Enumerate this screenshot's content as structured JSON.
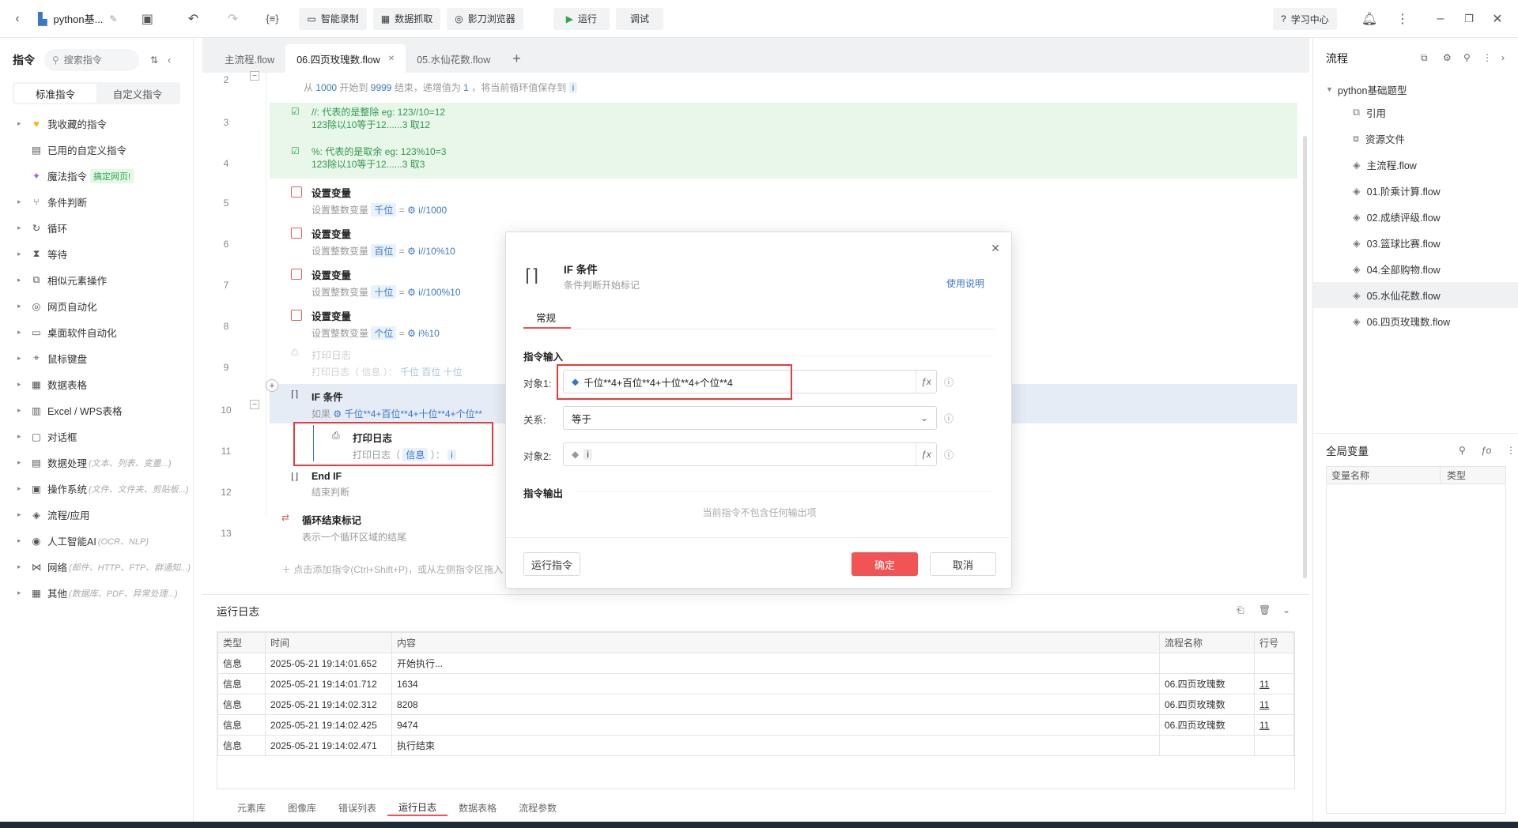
{
  "topbar": {
    "project_name": "python基...",
    "buttons": [
      "智能录制",
      "数据抓取",
      "影刀浏览器"
    ],
    "run": "运行",
    "debug": "调试",
    "learn": "学习中心"
  },
  "left": {
    "title": "指令",
    "search_placeholder": "搜索指令",
    "tab_standard": "标准指令",
    "tab_custom": "自定义指令",
    "items": [
      {
        "label": "我收藏的指令",
        "hint": "",
        "arrow": true,
        "icon": "heart-icon"
      },
      {
        "label": "已用的自定义指令",
        "hint": "",
        "arrow": false,
        "icon": "box-icon"
      },
      {
        "label": "魔法指令",
        "hint": "",
        "badge": "搞定网页!",
        "arrow": false,
        "icon": "magic-icon"
      },
      {
        "label": "条件判断",
        "hint": "",
        "arrow": true,
        "icon": "branch-icon"
      },
      {
        "label": "循环",
        "hint": "",
        "arrow": true,
        "icon": "loop-icon"
      },
      {
        "label": "等待",
        "hint": "",
        "arrow": true,
        "icon": "hourglass-icon"
      },
      {
        "label": "相似元素操作",
        "hint": "",
        "arrow": true,
        "icon": "copy-icon"
      },
      {
        "label": "网页自动化",
        "hint": "",
        "arrow": true,
        "icon": "globe-icon"
      },
      {
        "label": "桌面软件自动化",
        "hint": "",
        "arrow": true,
        "icon": "monitor-icon"
      },
      {
        "label": "鼠标键盘",
        "hint": "",
        "arrow": true,
        "icon": "mouse-icon"
      },
      {
        "label": "数据表格",
        "hint": "",
        "arrow": true,
        "icon": "table-icon"
      },
      {
        "label": "Excel / WPS表格",
        "hint": "",
        "arrow": true,
        "icon": "excel-icon"
      },
      {
        "label": "对话框",
        "hint": "",
        "arrow": true,
        "icon": "dialog-icon"
      },
      {
        "label": "数据处理",
        "hint": "(文本、列表、变量...)",
        "arrow": true,
        "icon": "data-icon"
      },
      {
        "label": "操作系统",
        "hint": "(文件、文件夹、剪贴板...)",
        "arrow": true,
        "icon": "os-icon"
      },
      {
        "label": "流程/应用",
        "hint": "",
        "arrow": true,
        "icon": "layers-icon"
      },
      {
        "label": "人工智能AI",
        "hint": "(OCR、NLP)",
        "arrow": true,
        "icon": "ai-icon"
      },
      {
        "label": "网络",
        "hint": "(邮件、HTTP、FTP、群通知...)",
        "arrow": true,
        "icon": "network-icon"
      },
      {
        "label": "其他",
        "hint": "(数据库、PDF、异常处理...)",
        "arrow": true,
        "icon": "grid-icon"
      }
    ]
  },
  "tabs": [
    {
      "label": "主流程.flow",
      "active": false,
      "close": false
    },
    {
      "label": "06.四页玫瑰数.flow",
      "active": true,
      "close": true
    },
    {
      "label": "05.水仙花数.flow",
      "active": false,
      "close": false
    }
  ],
  "editor": {
    "loop_desc": {
      "a": "从",
      "from": "1000",
      "b": "开始到",
      "to": "9999",
      "c": "结束，递增值为",
      "step": "1",
      "d": "，将当前循环值保存到",
      "var": "i"
    },
    "comment1": {
      "l1": "//: 代表的是整除  eg: 123//10=12",
      "l2": "123除以10等于12......3  取12"
    },
    "comment2": {
      "l1": "%: 代表的是取余  eg: 123%10=3",
      "l2": "123除以10等于12......3  取3"
    },
    "setvars": [
      {
        "title": "设置变量",
        "sub": "设置整数变量",
        "var": "千位",
        "expr": "i//1000"
      },
      {
        "title": "设置变量",
        "sub": "设置整数变量",
        "var": "百位",
        "expr": "i//10%10"
      },
      {
        "title": "设置变量",
        "sub": "设置整数变量",
        "var": "十位",
        "expr": "i//100%10"
      },
      {
        "title": "设置变量",
        "sub": "设置整数变量",
        "var": "个位",
        "expr": "i%10"
      }
    ],
    "disabled_log": {
      "title": "打印日志",
      "sub": "打印日志（ 信息 ）：",
      "vars": "千位  百位  十位"
    },
    "if": {
      "title": "IF 条件",
      "pre": "如果",
      "expr": "千位**4+百位**4+十位**4+个位**"
    },
    "print": {
      "title": "打印日志",
      "pre": "打印日志（",
      "level": "信息",
      "post": "）：",
      "var": "i"
    },
    "endif": {
      "title": "End IF",
      "sub": "结束判断"
    },
    "loopend": {
      "title": "循环结束标记",
      "sub": "表示一个循环区域的结尾"
    },
    "add_hint": "点击添加指令(Ctrl+Shift+P)，或从左侧指令区拖入",
    "line_numbers": [
      "2",
      "3",
      "4",
      "5",
      "6",
      "7",
      "8",
      "9",
      "10",
      "11",
      "12",
      "13"
    ]
  },
  "log": {
    "title": "运行日志",
    "headers": [
      "类型",
      "时间",
      "内容",
      "流程名称",
      "行号"
    ],
    "rows": [
      [
        "信息",
        "2025-05-21 19:14:01.652",
        "开始执行...",
        "",
        ""
      ],
      [
        "信息",
        "2025-05-21 19:14:01.712",
        "1634",
        "06.四页玫瑰数",
        "11"
      ],
      [
        "信息",
        "2025-05-21 19:14:02.312",
        "8208",
        "06.四页玫瑰数",
        "11"
      ],
      [
        "信息",
        "2025-05-21 19:14:02.425",
        "9474",
        "06.四页玫瑰数",
        "11"
      ],
      [
        "信息",
        "2025-05-21 19:14:02.471",
        "执行结束",
        "",
        ""
      ]
    ],
    "bottom_tabs": [
      "元素库",
      "图像库",
      "错误列表",
      "运行日志",
      "数据表格",
      "流程参数"
    ]
  },
  "right": {
    "title": "流程",
    "root": "python基础题型",
    "items": [
      "引用",
      "资源文件",
      "主流程.flow",
      "01.阶乘计算.flow",
      "02.成绩评级.flow",
      "03.篮球比赛.flow",
      "04.全部购物.flow",
      "05.水仙花数.flow",
      "06.四页玫瑰数.flow"
    ],
    "globals_title": "全局变量",
    "globals_headers": [
      "变量名称",
      "类型"
    ]
  },
  "modal": {
    "title": "IF 条件",
    "subtitle": "条件判断开始标记",
    "help": "使用说明",
    "tab": "常规",
    "input_section": "指令输入",
    "obj1_label": "对象1:",
    "obj1_value": "千位**4+百位**4+十位**4+个位**4",
    "rel_label": "关系:",
    "rel_value": "等于",
    "obj2_label": "对象2:",
    "obj2_value": "i",
    "output_section": "指令输出",
    "no_output": "当前指令不包含任何输出项",
    "run_btn": "运行指令",
    "ok": "确定",
    "cancel": "取消"
  },
  "colors": {
    "accent": "#3a78c4",
    "danger": "#f05454",
    "green_bg": "#e8f7ea",
    "highlight": "#e6ecf5"
  }
}
